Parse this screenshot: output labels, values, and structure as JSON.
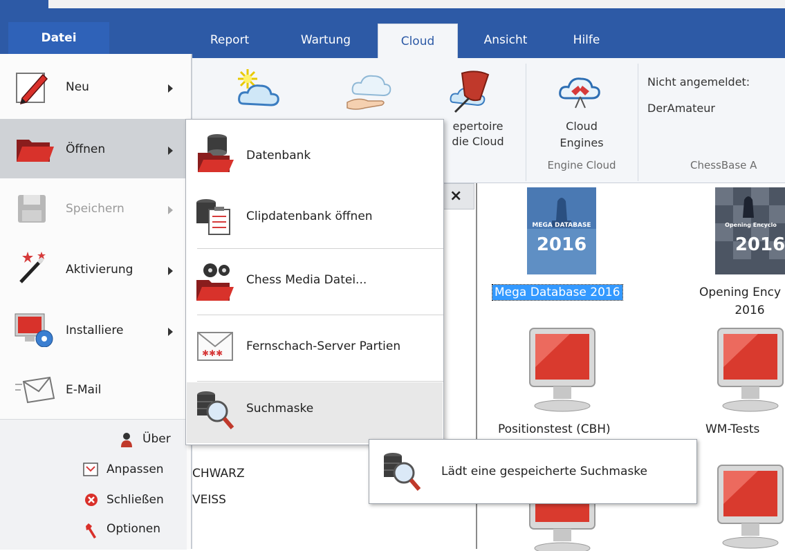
{
  "colors": {
    "accent": "#2d5aa6",
    "selection": "#3399ff"
  },
  "ribbon_tabs": {
    "datei": "Datei",
    "report": "Report",
    "wartung": "Wartung",
    "cloud": "Cloud",
    "ansicht": "Ansicht",
    "hilfe": "Hilfe"
  },
  "ribbon": {
    "repertoire_line1": "epertoire",
    "repertoire_line2": "die Cloud",
    "cloud_engines_line1": "Cloud",
    "cloud_engines_line2": "Engines",
    "group_engine_cloud": "Engine Cloud",
    "group_chessbase": "ChessBase A",
    "not_logged_in": "Nicht angemeldet:",
    "user": "DerAmateur"
  },
  "menu": {
    "neu": "Neu",
    "oeffnen": "Öffnen",
    "speichern": "Speichern",
    "aktivierung": "Aktivierung",
    "installiere": "Installiere",
    "email": "E-Mail",
    "ueber": "Über",
    "anpassen": "Anpassen",
    "schliessen": "Schließen",
    "optionen": "Optionen"
  },
  "submenu": {
    "datenbank": "Datenbank",
    "clipdatenbank": "Clipdatenbank öffnen",
    "chess_media": "Chess Media Datei...",
    "fernschach": "Fernschach-Server Partien",
    "suchmaske": "Suchmaske"
  },
  "tooltip": {
    "text": "Lädt eine gespeicherte Suchmaske"
  },
  "left_panel": {
    "close": "×",
    "schwarz": "CHWARZ",
    "weiss": "VEISS"
  },
  "databases": {
    "mega_cover_line1": "MEGA DATABASE",
    "mega_cover_line2": "2016",
    "mega": "Mega Database 2016",
    "opening_cover_line1": "Opening Encyclo",
    "opening_cover_line2": "2016",
    "opening_line1": "Opening Ency",
    "opening_line2": "2016",
    "positionstest": "Positionstest (CBH)",
    "wm_tests": "WM-Tests"
  }
}
